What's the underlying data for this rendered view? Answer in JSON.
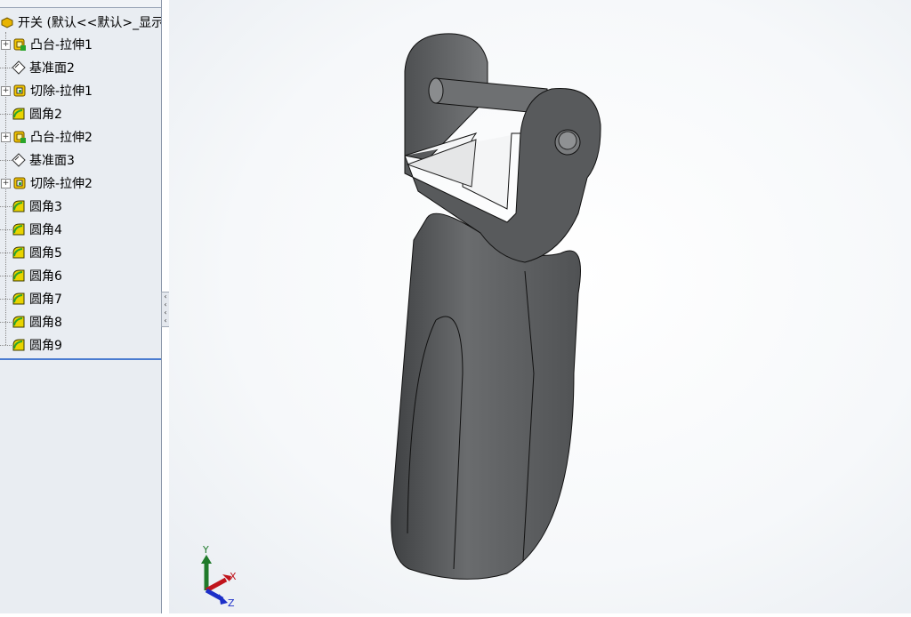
{
  "tree": {
    "root_label": "开关 (默认<<默认>_显示",
    "items": [
      {
        "label": "凸台-拉伸1",
        "icon": "extrude-boss-icon",
        "expandable": true
      },
      {
        "label": "基准面2",
        "icon": "plane-icon",
        "expandable": false
      },
      {
        "label": "切除-拉伸1",
        "icon": "extrude-cut-icon",
        "expandable": true
      },
      {
        "label": "圆角2",
        "icon": "fillet-icon",
        "expandable": false
      },
      {
        "label": "凸台-拉伸2",
        "icon": "extrude-boss-icon",
        "expandable": true
      },
      {
        "label": "基准面3",
        "icon": "plane-icon",
        "expandable": false
      },
      {
        "label": "切除-拉伸2",
        "icon": "extrude-cut-icon",
        "expandable": true
      },
      {
        "label": "圆角3",
        "icon": "fillet-icon",
        "expandable": false
      },
      {
        "label": "圆角4",
        "icon": "fillet-icon",
        "expandable": false
      },
      {
        "label": "圆角5",
        "icon": "fillet-icon",
        "expandable": false
      },
      {
        "label": "圆角6",
        "icon": "fillet-icon",
        "expandable": false
      },
      {
        "label": "圆角7",
        "icon": "fillet-icon",
        "expandable": false
      },
      {
        "label": "圆角8",
        "icon": "fillet-icon",
        "expandable": false
      },
      {
        "label": "圆角9",
        "icon": "fillet-icon",
        "expandable": false
      }
    ]
  },
  "triad": {
    "x": "X",
    "y": "Y",
    "z": "Z",
    "x_color": "#c0141c",
    "y_color": "#1f7a2a",
    "z_color": "#1c2fc8"
  },
  "colors": {
    "part": "#5a5c5e",
    "selection": "#4a7bd0"
  }
}
